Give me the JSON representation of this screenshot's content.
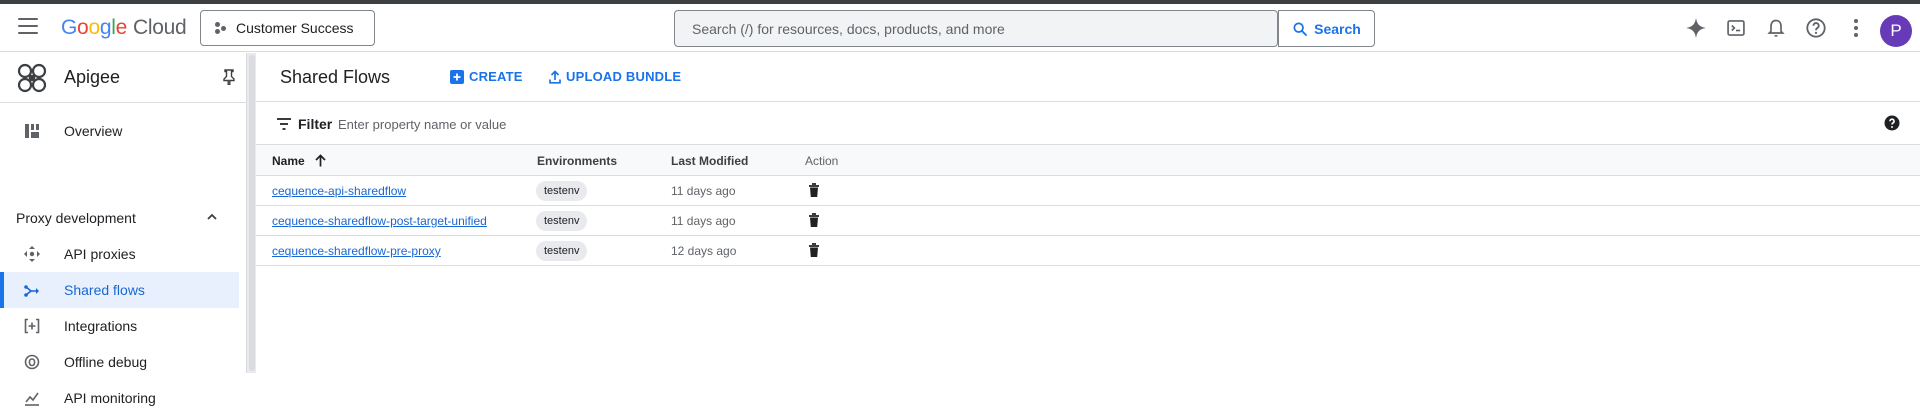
{
  "topbar": {
    "logo_letters": [
      "G",
      "o",
      "o",
      "g",
      "l",
      "e"
    ],
    "logo_product": "Cloud",
    "project_name": "Customer Success",
    "search_placeholder": "Search (/) for resources, docs, products, and more",
    "search_button": "Search",
    "avatar_initial": "P",
    "icons": [
      "gemini-icon",
      "cloud-shell-icon",
      "notifications-icon",
      "help-icon",
      "more-vert-icon"
    ]
  },
  "sidebar": {
    "product_name": "Apigee",
    "items_top": [
      {
        "label": "Overview",
        "icon": "dashboard-icon"
      }
    ],
    "section": {
      "label": "Proxy development",
      "expanded": true
    },
    "items": [
      {
        "label": "API proxies",
        "icon": "api-proxies-icon"
      },
      {
        "label": "Shared flows",
        "icon": "shared-flows-icon",
        "active": true
      },
      {
        "label": "Integrations",
        "icon": "integrations-icon"
      },
      {
        "label": "Offline debug",
        "icon": "offline-debug-icon"
      },
      {
        "label": "API monitoring",
        "icon": "api-monitoring-icon"
      }
    ]
  },
  "main": {
    "title": "Shared Flows",
    "create_label": "CREATE",
    "upload_label": "UPLOAD BUNDLE",
    "filter_label": "Filter",
    "filter_placeholder": "Enter property name or value",
    "columns": {
      "name": "Name",
      "environments": "Environments",
      "last_modified": "Last Modified",
      "action": "Action"
    },
    "rows": [
      {
        "name": "cequence-api-sharedflow",
        "env": "testenv",
        "modified": "11 days ago"
      },
      {
        "name": "cequence-sharedflow-post-target-unified",
        "env": "testenv",
        "modified": "11 days ago"
      },
      {
        "name": "cequence-sharedflow-pre-proxy",
        "env": "testenv",
        "modified": "12 days ago"
      }
    ]
  },
  "colors": {
    "accent": "#1a73e8",
    "active_bg": "#e8f0fe",
    "avatar": "#673ab7"
  }
}
